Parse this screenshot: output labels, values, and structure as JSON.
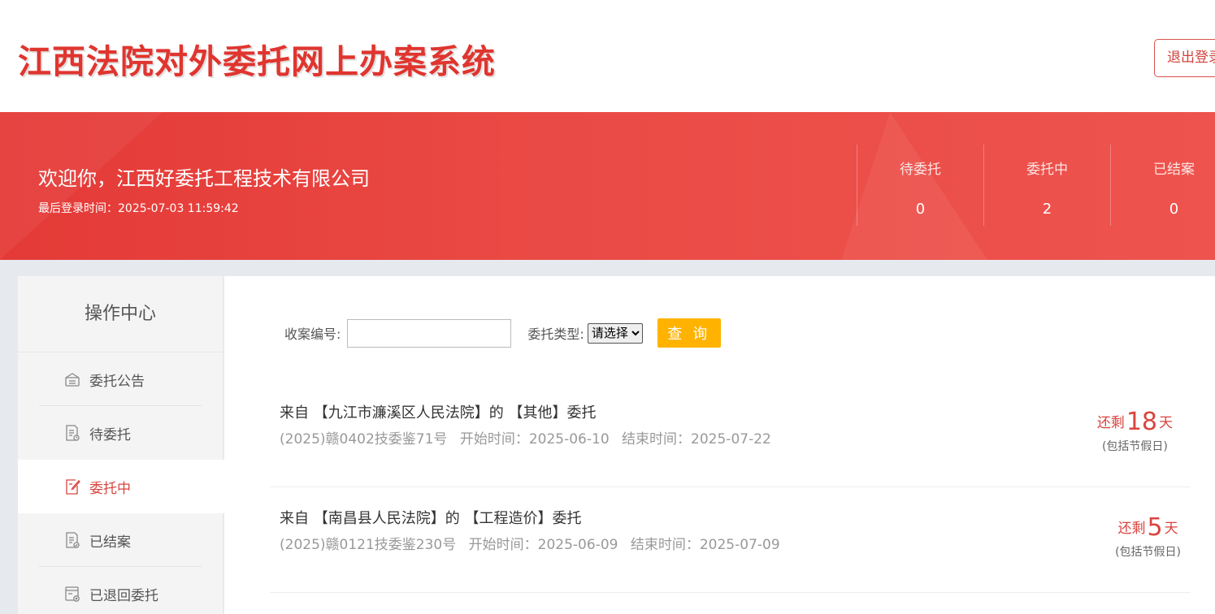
{
  "header": {
    "system_title": "江西法院对外委托网上办案系统",
    "logout_label": "退出登录"
  },
  "banner": {
    "welcome": "欢迎你，江西好委托工程技术有限公司",
    "last_login": "最后登录时间：2025-07-03 11:59:42",
    "stats": [
      {
        "label": "待委托",
        "value": "0"
      },
      {
        "label": "委托中",
        "value": "2"
      },
      {
        "label": "已结案",
        "value": "0"
      }
    ]
  },
  "sidebar": {
    "title": "操作中心",
    "items": [
      {
        "label": "委托公告",
        "icon": "announcement-icon"
      },
      {
        "label": "待委托",
        "icon": "pending-doc-icon"
      },
      {
        "label": "委托中",
        "icon": "edit-doc-icon"
      },
      {
        "label": "已结案",
        "icon": "closed-doc-icon"
      },
      {
        "label": "已退回委托",
        "icon": "returned-doc-icon"
      }
    ],
    "active_index": 2
  },
  "search": {
    "case_no_label": "收案编号:",
    "case_no_value": "",
    "type_label": "委托类型:",
    "type_selected": "请选择",
    "query_label": "查 询"
  },
  "cases": [
    {
      "title": "来自 【九江市濂溪区人民法院】的 【其他】委托",
      "case_no": "(2025)赣0402技委鉴71号",
      "start": "开始时间：2025-06-10",
      "end": "结束时间：2025-07-22",
      "remain_prefix": "还剩",
      "remain_days": "18",
      "remain_suffix": "天",
      "note": "(包括节假日)"
    },
    {
      "title": "来自 【南昌县人民法院】的 【工程造价】委托",
      "case_no": "(2025)赣0121技委鉴230号",
      "start": "开始时间：2025-06-09",
      "end": "结束时间：2025-07-09",
      "remain_prefix": "还剩",
      "remain_days": "5",
      "remain_suffix": "天",
      "note": "(包括节假日)"
    }
  ],
  "colors": {
    "brand_red": "#e0352f",
    "banner_red": "#e8443f",
    "query_button": "#ffb300"
  }
}
